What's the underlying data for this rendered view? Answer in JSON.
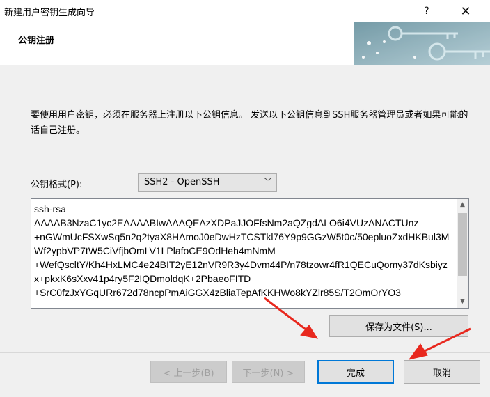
{
  "window": {
    "title": "新建用户密钥生成向导",
    "help_label": "?",
    "close_label": "✕"
  },
  "header": {
    "title": "公钥注册"
  },
  "main": {
    "description": "要使用用户密钥，必须在服务器上注册以下公钥信息。 发送以下公钥信息到SSH服务器管理员或者如果可能的话自己注册。",
    "format_label": "公钥格式(P):",
    "format_value": "SSH2 - OpenSSH",
    "public_key_text": "ssh-rsa\nAAAAB3NzaC1yc2EAAAABIwAAAQEAzXDPaJJOFfsNm2aQZgdALO6i4VUzANACTUnz\n+nGWmUcFSXwSq5n2q2tyaX8HAmoJ0eDwHzTCSTkl76Y9p9GGzW5t0c/50epluoZxdHKBul3MWf2ypbVP7tW5CiVfjbOmLV1LPlafoCE9OdHeh4mNmM\n+WefQscltY/Kh4HxLMC4e24BIT2yE12nVR9R3y4Dvm44P/n78tzowr4fR1QECuQomy37dKsbiyzx+pkxK6sXxv41p4ry5F2IQDmoldqK+2PbaeoFITD\n+SrC0fzJxYGqURr672d78ncpPmAiGGX4zBliaTepAfKKHWo8kYZlr85S/T2OmOrYO3",
    "save_button": "保存为文件(S)..."
  },
  "footer": {
    "back_button": "< 上一步(B)",
    "next_button": "下一步(N) >",
    "finish_button": "完成",
    "cancel_button": "取消"
  },
  "colors": {
    "accent": "#0078d7",
    "annotation_arrow": "#e8281e",
    "banner": "#6f9aa8"
  }
}
